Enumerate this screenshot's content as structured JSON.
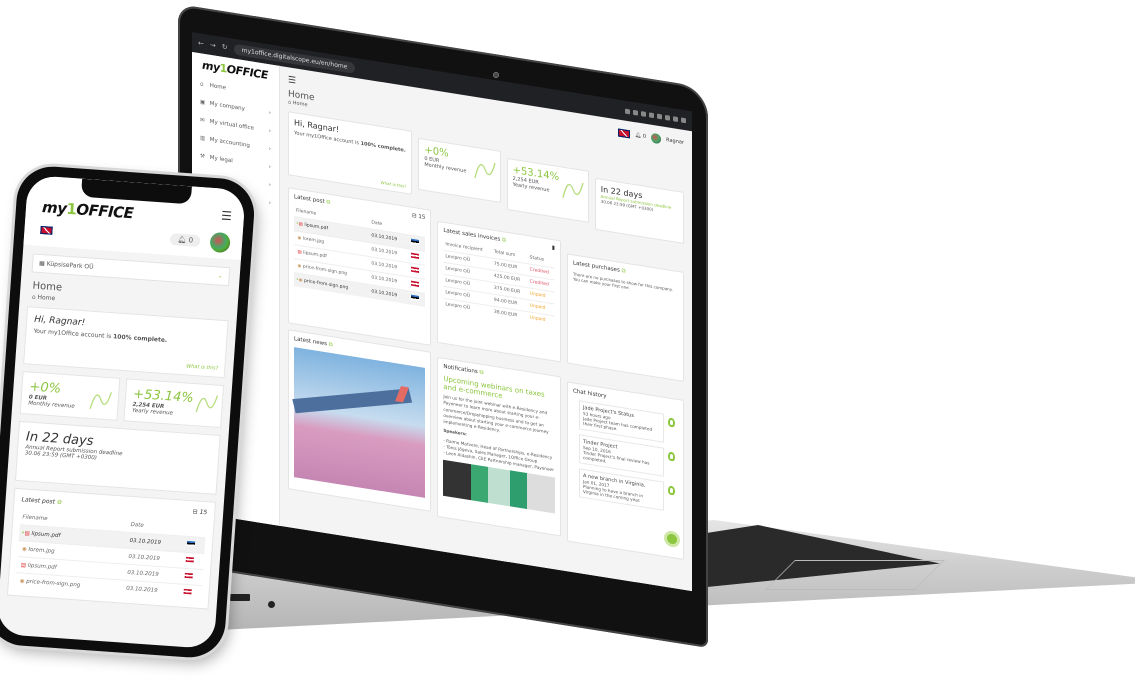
{
  "browser": {
    "url": "my1office.digitalscope.eu/en/home"
  },
  "brand": {
    "logo_prefix": "my",
    "logo_one": "1",
    "logo_suffix": "OFFICE",
    "accent_color": "#8cc63f"
  },
  "sidebar": {
    "items": [
      {
        "label": "Home",
        "icon": "home-icon"
      },
      {
        "label": "My company",
        "icon": "briefcase-icon"
      },
      {
        "label": "My virtual office",
        "icon": "mail-icon"
      },
      {
        "label": "My accounting",
        "icon": "chart-icon"
      },
      {
        "label": "My legal",
        "icon": "gavel-icon"
      }
    ]
  },
  "topbar": {
    "notifications_count": "0",
    "user_name": "Ragnar",
    "company": "KüpsisePark OÜ"
  },
  "page": {
    "title": "Home",
    "breadcrumb": "Home"
  },
  "welcome": {
    "greeting": "Hi, Ragnar!",
    "text_prefix": "Your my1Office account is ",
    "text_bold": "100% complete.",
    "link": "What is this?"
  },
  "stats": {
    "monthly": {
      "change": "+0%",
      "amount": "0 EUR",
      "label": "Monthly revenue"
    },
    "yearly": {
      "change": "+53.14%",
      "amount": "2,254 EUR",
      "label": "Yearly revenue"
    }
  },
  "deadline": {
    "title": "In 22 days",
    "subtitle": "Annual Report submission deadline",
    "date": "30.06 23:59 (GMT +0300)"
  },
  "latest_post": {
    "title": "Latest post",
    "count": "15",
    "columns": [
      "Filename",
      "Date"
    ],
    "rows": [
      {
        "name": "lipsum.pdf",
        "date": "03.10.2019",
        "flag": "ee",
        "new": true,
        "type": "pdf"
      },
      {
        "name": "lorem.jpg",
        "date": "03.10.2019",
        "flag": "at",
        "new": false,
        "type": "img"
      },
      {
        "name": "lipsum.pdf",
        "date": "03.10.2019",
        "flag": "at",
        "new": false,
        "type": "pdf"
      },
      {
        "name": "price-from-sign.png",
        "date": "03.10.2019",
        "flag": "at",
        "new": false,
        "type": "img"
      },
      {
        "name": "price-from-sign.png",
        "date": "03.10.2019",
        "flag": "ee",
        "new": true,
        "type": "img"
      }
    ]
  },
  "invoices": {
    "title": "Latest sales invoices",
    "columns": [
      "Invoice recipient",
      "Total sum",
      "Status"
    ],
    "rows": [
      {
        "recipient": "Levipro OÜ",
        "sum": "75.00 EUR",
        "status": "Credited"
      },
      {
        "recipient": "Levipro OÜ",
        "sum": "425.00 EUR",
        "status": "Credited"
      },
      {
        "recipient": "Levipro OÜ",
        "sum": "375.00 EUR",
        "status": "Unpaid"
      },
      {
        "recipient": "Levipro OÜ",
        "sum": "94.00 EUR",
        "status": "Unpaid"
      },
      {
        "recipient": "Levipro OÜ",
        "sum": "38.00 EUR",
        "status": "Unpaid"
      }
    ]
  },
  "purchases": {
    "title": "Latest purchases",
    "empty_text": "There are no purchases to show for this company. You can make your first one."
  },
  "news": {
    "title": "Latest news"
  },
  "notifications": {
    "title": "Notifications",
    "headline": "Upcoming webinars on taxes and e-commerce",
    "body": "Join us for the joint webinar with e-Residency and Payoneer to learn more about starting your e-commerce/Dropshipping business and to get an overview about starting your e-commerce journey implementing e-Residency.",
    "speakers_label": "Speakers:",
    "speakers": [
      "- Raimo Matvere, Head of Partnerships, e-Residency",
      "- Tõnis Jõgeva, Sales Manager, 1Office Group",
      "- Leon Aldashin, CEE Partnership manager, Payoneer"
    ]
  },
  "chat": {
    "title": "Chat history",
    "items": [
      {
        "title": "Jade Project's Status",
        "time": "53 hours ago",
        "text": "Jade Project team has completed their first phase."
      },
      {
        "title": "Tinder Project",
        "time": "Sep 10, 2016",
        "text": "Tinder Project's final review has completed."
      },
      {
        "title": "A new branch in Virginia.",
        "time": "Jan 01, 2017",
        "text": "Planning to have a branch in Virginia in the coming year."
      }
    ]
  }
}
